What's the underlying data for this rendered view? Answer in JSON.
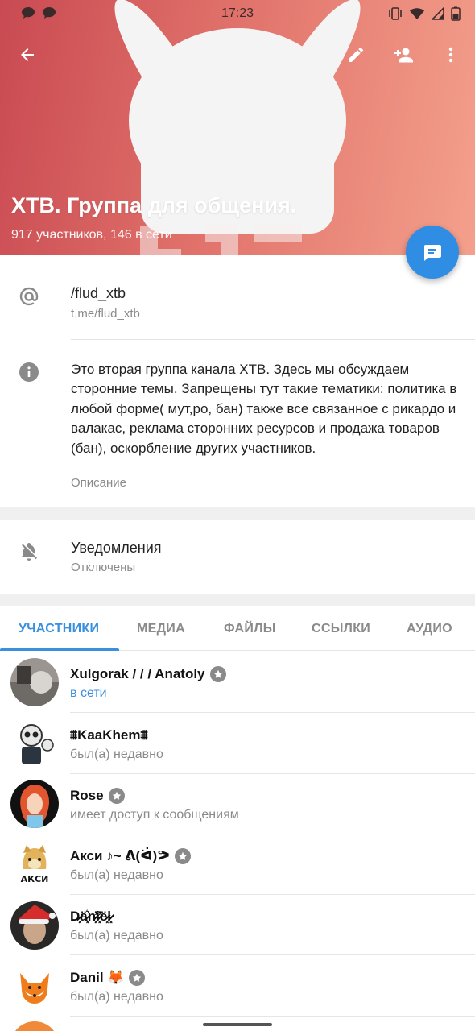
{
  "status_bar": {
    "time": "17:23"
  },
  "header": {
    "title": "XTB. Группа для общения.",
    "subtitle": "917 участников, 146 в сети",
    "bg_color_start": "#c94a52",
    "bg_color_end": "#f4a08c"
  },
  "toolbar": {
    "back_icon": "arrow-left",
    "edit_icon": "pencil",
    "add_member_icon": "person-add",
    "more_icon": "more-vert"
  },
  "fab": {
    "icon": "chat-bubble",
    "color": "#2f8de4"
  },
  "username": {
    "value": "/flud_xtb",
    "link": "t.me/flud_xtb"
  },
  "description": {
    "text": "Это вторая группа канала XTB. Здесь мы обсуждаем сторонние темы. Запрещены тут такие тематики: политика в любой форме( мут,ро, бан) также все связанное с рикардо и валакас, реклама сторонних ресурсов и продажа товаров (бан), оскорбление других участников.",
    "label": "Описание"
  },
  "notifications": {
    "title": "Уведомления",
    "state": "Отключены"
  },
  "tabs": [
    "УЧАСТНИКИ",
    "МЕДИА",
    "ФАЙЛЫ",
    "ССЫЛКИ",
    "АУДИО"
  ],
  "accent_color": "#3a8fde",
  "members": [
    {
      "name": "Xulgorak / / / Anatoly",
      "status": "в сети",
      "admin": true
    },
    {
      "name": "⩩KaaKhem⩩",
      "status": "был(а) недавно",
      "admin": false
    },
    {
      "name": "Rose",
      "status": "имеет доступ к сообщениям",
      "admin": true
    },
    {
      "name": "Акси ♪~ ᕕ(ᐛ)ᕗ",
      "status": "был(а) недавно",
      "admin": true
    },
    {
      "name": "D̷̷̷̷͓ä̷̷͓͛n̷̷̷̷̷͓̓i̷̷̷̷̷̷͓̓ë̷̷̷̷̷̷͓l̷̷̷̷̷̷̷̷̷͓",
      "status": "был(а) недавно",
      "admin": false
    },
    {
      "name": "Danil 🦊",
      "status": "был(а) недавно",
      "admin": true
    }
  ]
}
